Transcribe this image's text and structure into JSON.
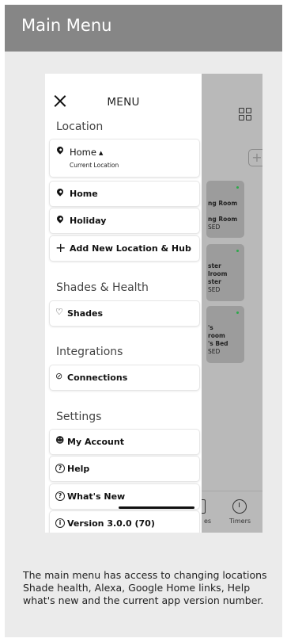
{
  "header": {
    "title": "Main Menu"
  },
  "menu": {
    "title": "MENU",
    "sections": {
      "location": "Location",
      "shades_health": "Shades & Health",
      "integrations": "Integrations",
      "settings": "Settings"
    },
    "current_location": {
      "label": "Home",
      "caret": "▲",
      "sub": "Current Location"
    },
    "items": {
      "home": "Home",
      "holiday": "Holiday",
      "add_location": "Add New Location & Hub",
      "shades": "Shades",
      "connections": "Connections",
      "my_account": "My Account",
      "help": "Help",
      "whats_new": "What's New",
      "version": "Version 3.0.0 (70)"
    }
  },
  "background_app": {
    "cards": [
      {
        "lines": [
          "ng Room",
          "",
          "ng Room",
          "SED"
        ]
      },
      {
        "lines": [
          "ster",
          "lroom",
          "ster",
          "SED"
        ]
      },
      {
        "lines": [
          "'s",
          "room",
          "'s Bed",
          "SED"
        ]
      }
    ],
    "tabs": {
      "partial": "es",
      "timers": "Timers"
    }
  },
  "caption": "The main menu has access to changing locations Shade health, Alexa, Google Home links, Help what's new and the current app version number."
}
